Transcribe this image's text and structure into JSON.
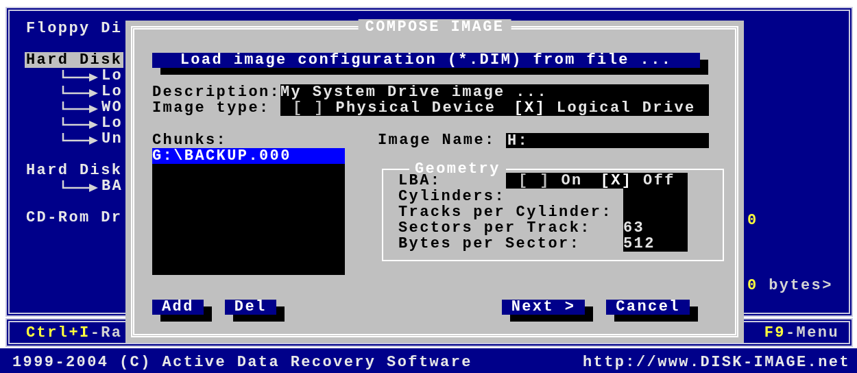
{
  "screen": {
    "sections": [
      {
        "label": "Floppy Di",
        "selected": false
      },
      {
        "label": "Hard Disk",
        "selected": true,
        "items": [
          "Lo",
          "Lo",
          "WO",
          "Lo",
          "Un"
        ]
      },
      {
        "label": "Hard Disk",
        "selected": false,
        "items": [
          "BA"
        ]
      },
      {
        "label": "CD-Rom Dr",
        "selected": false
      }
    ],
    "readouts": [
      {
        "value": "0"
      },
      {
        "value": "0",
        "suffix": "bytes>"
      }
    ]
  },
  "dialog": {
    "title": "COMPOSE IMAGE",
    "load_button": "Load image configuration (*.DIM) from file ...",
    "description": {
      "label": "Description:",
      "value": "My System Drive image ..."
    },
    "image_type": {
      "label": "Image type:",
      "options": [
        {
          "box": "[ ]",
          "label": "Physical Device",
          "checked": false
        },
        {
          "box": "[X]",
          "label": "Logical Drive",
          "checked": true
        }
      ]
    },
    "chunks": {
      "label": "Chunks:",
      "items": [
        {
          "text": "G:\\BACKUP.000",
          "selected": true
        }
      ]
    },
    "image_name": {
      "label": "Image Name:",
      "value": "H:"
    },
    "geometry": {
      "title": "Geometry",
      "lba": {
        "label": "LBA:",
        "options": [
          {
            "box": "[ ]",
            "label": "On",
            "checked": false
          },
          {
            "box": "[X]",
            "label": "Off",
            "checked": true
          }
        ]
      },
      "fields": [
        {
          "label": "Cylinders:"
        },
        {
          "label": "Tracks per Cylinder:"
        },
        {
          "label": "Sectors per Track:",
          "value": "63"
        },
        {
          "label": "Bytes per Sector:",
          "value": "512"
        }
      ]
    },
    "buttons": [
      "Add",
      "Del",
      "Next >",
      "Cancel"
    ]
  },
  "key_bar": {
    "left": {
      "key": "Ctrl+I",
      "action": "-Ra"
    },
    "right": {
      "key": "F9",
      "action": "-Menu"
    }
  },
  "status_bar": {
    "copyright": "1999-2004 (C) Active Data Recovery Software",
    "url": "http://www.DISK-IMAGE.net"
  }
}
